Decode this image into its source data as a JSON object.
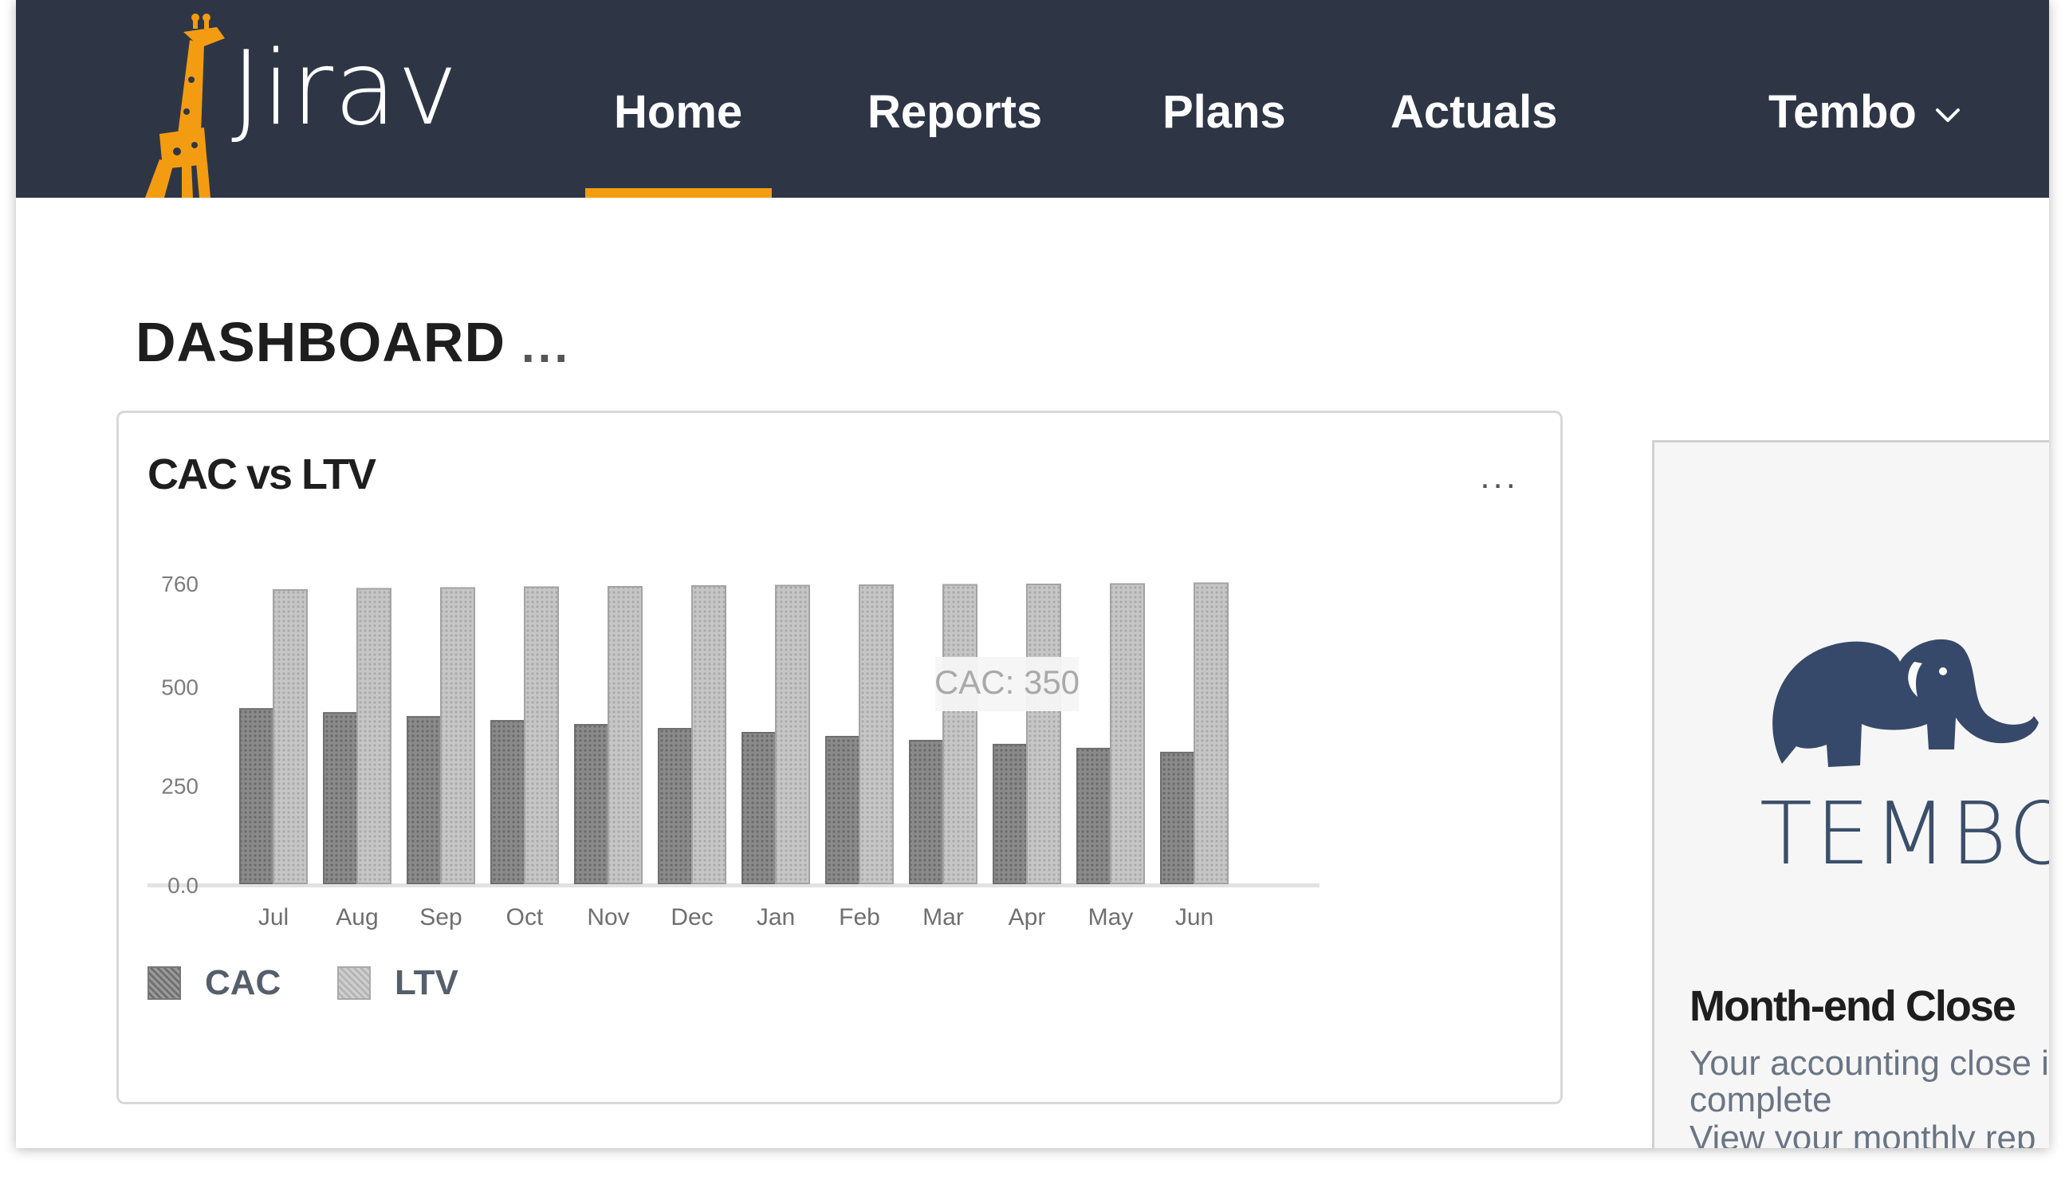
{
  "nav": {
    "logo_text": "Jirav",
    "items": [
      {
        "label": "Home"
      },
      {
        "label": "Reports"
      },
      {
        "label": "Plans"
      },
      {
        "label": "Actuals"
      }
    ],
    "active_item": "Home",
    "user_menu": {
      "label": "Tembo",
      "icon": "chevron-down-icon"
    },
    "colors": {
      "background": "#2e3646",
      "accent": "#f39c12"
    }
  },
  "dashboard": {
    "title": "DASHBOARD",
    "more": "..."
  },
  "chart_card": {
    "title": "CAC vs LTV",
    "more": "...",
    "tooltip": "CAC: 350"
  },
  "chart_data": {
    "type": "bar",
    "categories": [
      "Jul",
      "Aug",
      "Sep",
      "Oct",
      "Nov",
      "Dec",
      "Jan",
      "Feb",
      "Mar",
      "Apr",
      "May",
      "Jun"
    ],
    "series": [
      {
        "name": "CAC",
        "values": [
          440,
          430,
          420,
          410,
          400,
          390,
          380,
          370,
          360,
          350,
          340,
          330
        ]
      },
      {
        "name": "LTV",
        "values": [
          740,
          743,
          745,
          747,
          748,
          750,
          751,
          752,
          753,
          754,
          755,
          757
        ]
      }
    ],
    "yticks": [
      "760",
      "500",
      "250",
      "0.0"
    ],
    "ylim": [
      0,
      760
    ],
    "legend": [
      "CAC",
      "LTV"
    ],
    "legend_position": "bottom-left",
    "grid": false
  },
  "tembo_card": {
    "logo_text": "TEMBO",
    "title": "Month-end Close",
    "description": "Your accounting close is complete",
    "link": "View your monthly rep"
  }
}
